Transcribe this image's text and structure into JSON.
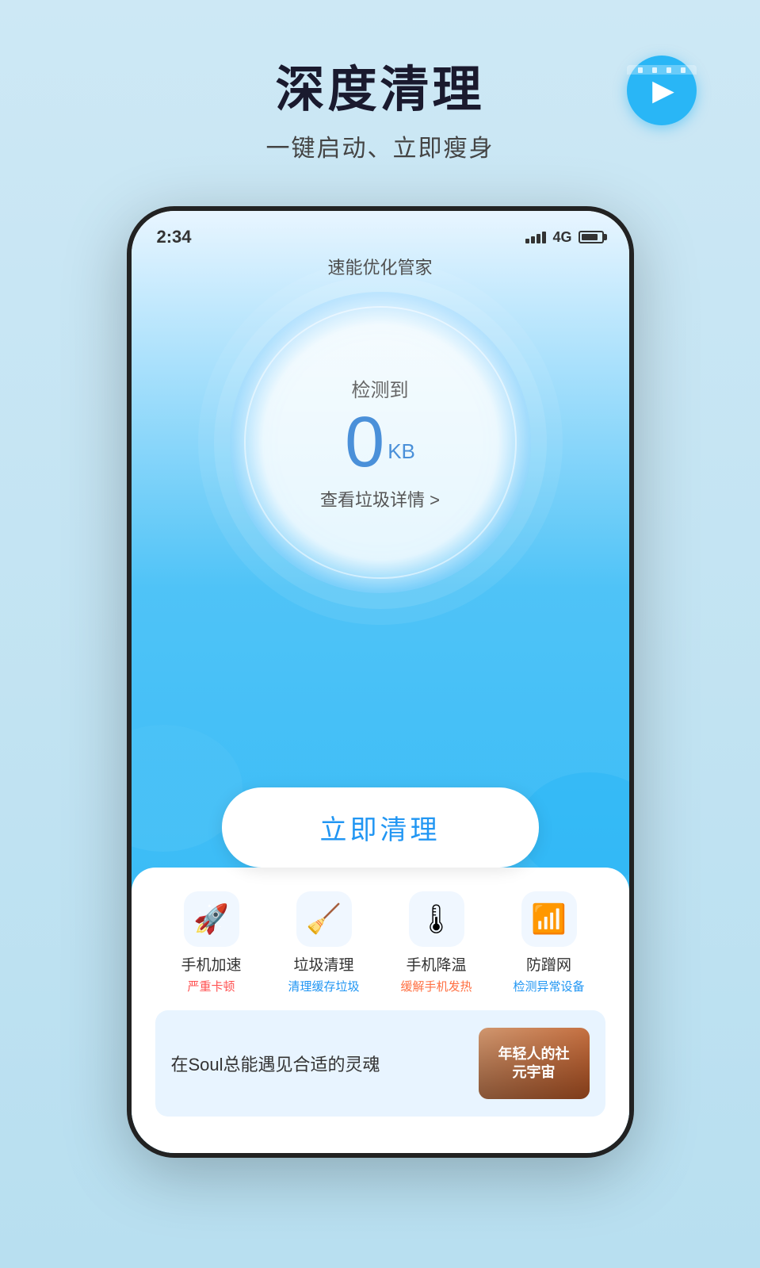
{
  "header": {
    "main_title": "深度清理",
    "sub_title": "一键启动、立即瘦身",
    "video_icon_label": "video-play-icon"
  },
  "status_bar": {
    "time": "2:34",
    "network": "4G"
  },
  "app": {
    "title": "速能优化管家",
    "gauge": {
      "label": "检测到",
      "value": "0",
      "unit": "KB",
      "detail": "查看垃圾详情 >"
    },
    "clean_button": "立即清理"
  },
  "features": [
    {
      "icon": "🚀",
      "name": "手机加速",
      "desc": "严重卡顿",
      "desc_color": "red"
    },
    {
      "icon": "🧹",
      "name": "垃圾清理",
      "desc": "清理缓存垃圾",
      "desc_color": "blue"
    },
    {
      "icon": "🌡",
      "name": "手机降温",
      "desc": "缓解手机发热",
      "desc_color": "orange"
    },
    {
      "icon": "📶",
      "name": "防蹭网",
      "desc": "检测异常设备",
      "desc_color": "blue"
    }
  ],
  "ad_banner": {
    "text": "在Soul总能遇见合适的灵魂",
    "image_text": "年轻人的社\n元宇宙"
  }
}
